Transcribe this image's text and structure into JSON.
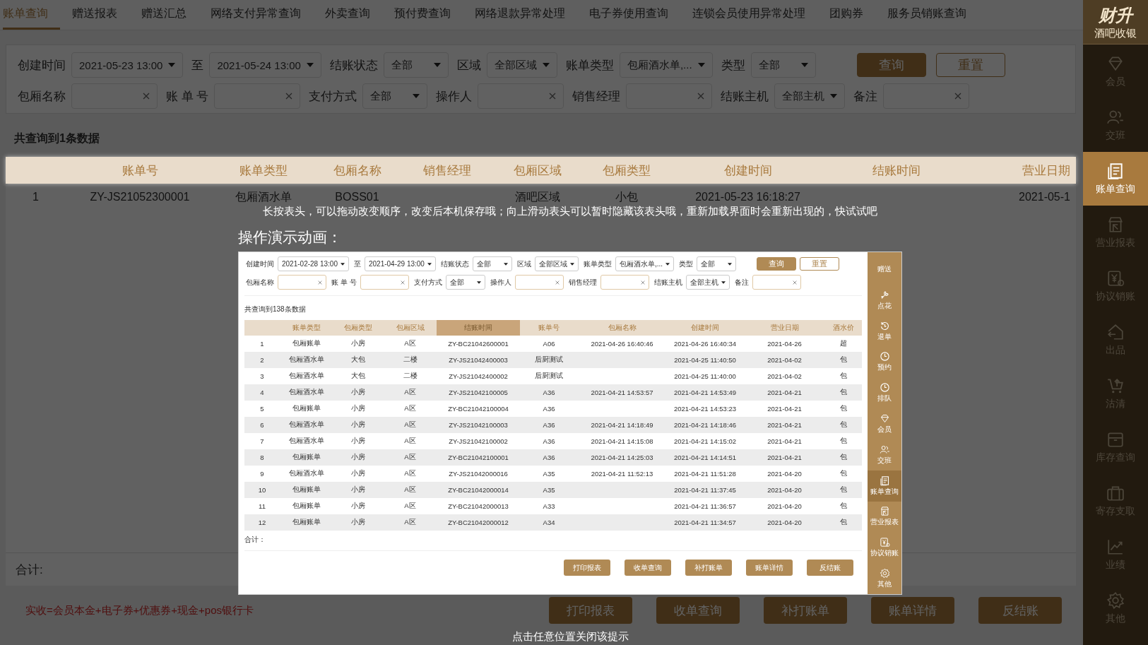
{
  "tabs": [
    {
      "label": "账单查询",
      "selected": true
    },
    {
      "label": "赠送报表",
      "selected": false
    },
    {
      "label": "赠送汇总",
      "selected": false
    },
    {
      "label": "网络支付异常查询",
      "selected": false
    },
    {
      "label": "外卖查询",
      "selected": false
    },
    {
      "label": "预付费查询",
      "selected": false
    },
    {
      "label": "网络退款异常处理",
      "selected": false
    },
    {
      "label": "电子券使用查询",
      "selected": false
    },
    {
      "label": "连锁会员使用异常处理",
      "selected": false
    },
    {
      "label": "团购券",
      "selected": false
    },
    {
      "label": "服务员销账查询",
      "selected": false
    }
  ],
  "brand": {
    "name": "财升",
    "subtitle": "酒吧收银"
  },
  "sidebar": {
    "items": [
      {
        "label": "会员",
        "selected": false
      },
      {
        "label": "交班",
        "selected": false
      },
      {
        "label": "账单查询",
        "selected": true
      },
      {
        "label": "营业报表",
        "selected": false
      },
      {
        "label": "协议销账",
        "selected": false
      },
      {
        "label": "出品",
        "selected": false
      },
      {
        "label": "沽清",
        "selected": false
      },
      {
        "label": "库存查询",
        "selected": false
      },
      {
        "label": "寄存支取",
        "selected": false
      },
      {
        "label": "业绩",
        "selected": false
      },
      {
        "label": "其他",
        "selected": false
      }
    ]
  },
  "filters": [
    [
      {
        "kind": "label",
        "text": "创建时间"
      },
      {
        "kind": "select",
        "value": "2021-05-23 13:00"
      },
      {
        "kind": "label",
        "text": "至"
      },
      {
        "kind": "select",
        "value": "2021-05-24 13:00"
      },
      {
        "kind": "label",
        "text": "结账状态"
      },
      {
        "kind": "select",
        "value": "全部"
      },
      {
        "kind": "label",
        "text": "区域"
      },
      {
        "kind": "select",
        "value": "全部区域"
      },
      {
        "kind": "label",
        "text": "账单类型"
      },
      {
        "kind": "select",
        "value": "包厢酒水单,..."
      },
      {
        "kind": "label",
        "text": "类型"
      },
      {
        "kind": "select",
        "value": "全部"
      },
      {
        "kind": "primary",
        "text": "查询"
      },
      {
        "kind": "button",
        "text": "重置"
      }
    ],
    [
      {
        "kind": "label",
        "text": "包厢名称"
      },
      {
        "kind": "input"
      },
      {
        "kind": "label",
        "text": "账 单 号"
      },
      {
        "kind": "input"
      },
      {
        "kind": "label",
        "text": "支付方式"
      },
      {
        "kind": "select",
        "value": "全部"
      },
      {
        "kind": "label",
        "text": "操作人"
      },
      {
        "kind": "input"
      },
      {
        "kind": "label",
        "text": "销售经理"
      },
      {
        "kind": "input"
      },
      {
        "kind": "label",
        "text": "结账主机"
      },
      {
        "kind": "select",
        "value": "全部主机"
      },
      {
        "kind": "label",
        "text": "备注"
      },
      {
        "kind": "input"
      }
    ]
  ],
  "result_count": "共查询到1条数据",
  "table": {
    "columns": [
      "",
      "账单号",
      "账单类型",
      "包厢名称",
      "销售经理",
      "包厢区域",
      "包厢类型",
      "创建时间",
      "结账时间",
      "营业日期"
    ],
    "rows": [
      [
        "1",
        "ZY-JS21052300001",
        "包厢酒水单",
        "BOSS01",
        "",
        "酒吧区域",
        "小包",
        "2021-05-23 16:18:27",
        "",
        "2021-05-1"
      ]
    ]
  },
  "total_label": "合计:",
  "formula_note": "实收=会员本金+电子券+优惠券+现金+pos银行卡",
  "actions": [
    "打印报表",
    "收单查询",
    "补打账单",
    "账单详情",
    "反结账"
  ],
  "tip": {
    "hint": "长按表头，可以拖动改变顺序，改变后本机保存哦；向上滑动表头可以暂时隐藏该表头哦，重新加载界面时会重新出现的，快试试吧",
    "demo_title": "操作演示动画：",
    "close_hint": "点击任意位置关闭该提示",
    "demo": {
      "filters": [
        [
          {
            "kind": "label",
            "text": "创建时间"
          },
          {
            "kind": "select",
            "value": "2021-02-28 13:00"
          },
          {
            "kind": "label",
            "text": "至"
          },
          {
            "kind": "select",
            "value": "2021-04-29 13:00"
          },
          {
            "kind": "label",
            "text": "结账状态"
          },
          {
            "kind": "select",
            "value": "全部"
          },
          {
            "kind": "label",
            "text": "区域"
          },
          {
            "kind": "select",
            "value": "全部区域"
          },
          {
            "kind": "label",
            "text": "账单类型"
          },
          {
            "kind": "select",
            "value": "包厢酒水单,..."
          },
          {
            "kind": "label",
            "text": "类型"
          },
          {
            "kind": "select",
            "value": "全部"
          },
          {
            "kind": "primary",
            "text": "查询"
          },
          {
            "kind": "button",
            "text": "重置"
          }
        ],
        [
          {
            "kind": "label",
            "text": "包厢名称"
          },
          {
            "kind": "input"
          },
          {
            "kind": "label",
            "text": "账 单 号"
          },
          {
            "kind": "input"
          },
          {
            "kind": "label",
            "text": "支付方式"
          },
          {
            "kind": "select",
            "value": "全部"
          },
          {
            "kind": "label",
            "text": "操作人"
          },
          {
            "kind": "input"
          },
          {
            "kind": "label",
            "text": "销售经理"
          },
          {
            "kind": "input"
          },
          {
            "kind": "label",
            "text": "结账主机"
          },
          {
            "kind": "select",
            "value": "全部主机"
          },
          {
            "kind": "label",
            "text": "备注"
          },
          {
            "kind": "input"
          }
        ]
      ],
      "result_count": "共查询到138条数据",
      "columns": [
        {
          "dragging": false
        },
        {
          "label": "账单类型",
          "dragging": false
        },
        {
          "label": "包厢类型",
          "dragging": false
        },
        {
          "label": "包厢区域",
          "dragging": false
        },
        {
          "label": "结账时间",
          "dragging": true
        },
        {
          "label": "账单号",
          "dragging": false
        },
        {
          "label": "包厢名称",
          "dragging": false
        },
        {
          "label": "创建时间",
          "dragging": false
        },
        {
          "label": "营业日期",
          "dragging": false
        },
        {
          "label": "酒水价",
          "dragging": false
        }
      ],
      "rows": [
        [
          "1",
          "包厢账单",
          "小房",
          "A区",
          "ZY-BC21042600001",
          "A06",
          "2021-04-26 16:40:46",
          "2021-04-26 16:40:34",
          "2021-04-26",
          "超"
        ],
        [
          "2",
          "包厢酒水单",
          "大包",
          "二楼",
          "ZY-JS21042400003",
          "后厨测试",
          "",
          "2021-04-25 11:40:50",
          "2021-04-02",
          "包"
        ],
        [
          "3",
          "包厢酒水单",
          "大包",
          "二楼",
          "ZY-JS21042400002",
          "后厨测试",
          "",
          "2021-04-25 11:40:00",
          "2021-04-02",
          "包"
        ],
        [
          "4",
          "包厢酒水单",
          "小房",
          "A区",
          "ZY-JS21042100005",
          "A36",
          "2021-04-21 14:53:57",
          "2021-04-21 14:53:49",
          "2021-04-21",
          "包"
        ],
        [
          "5",
          "包厢账单",
          "小房",
          "A区",
          "ZY-BC21042100004",
          "A36",
          "",
          "2021-04-21 14:53:23",
          "2021-04-21",
          "包"
        ],
        [
          "6",
          "包厢酒水单",
          "小房",
          "A区",
          "ZY-JS21042100003",
          "A36",
          "2021-04-21 14:18:49",
          "2021-04-21 14:18:46",
          "2021-04-21",
          "包"
        ],
        [
          "7",
          "包厢酒水单",
          "小房",
          "A区",
          "ZY-JS21042100002",
          "A36",
          "2021-04-21 14:15:08",
          "2021-04-21 14:15:02",
          "2021-04-21",
          "包"
        ],
        [
          "8",
          "包厢账单",
          "小房",
          "A区",
          "ZY-BC21042100001",
          "A36",
          "2021-04-21 14:25:03",
          "2021-04-21 14:14:51",
          "2021-04-21",
          "包"
        ],
        [
          "9",
          "包厢酒水单",
          "小房",
          "A区",
          "ZY-JS21042000016",
          "A35",
          "2021-04-21 11:52:13",
          "2021-04-21 11:51:28",
          "2021-04-20",
          "包"
        ],
        [
          "10",
          "包厢账单",
          "小房",
          "A区",
          "ZY-BC21042000014",
          "A35",
          "",
          "2021-04-21 11:37:45",
          "2021-04-20",
          "包"
        ],
        [
          "11",
          "包厢账单",
          "小房",
          "A区",
          "ZY-BC21042000013",
          "A33",
          "",
          "2021-04-21 11:36:57",
          "2021-04-20",
          "包"
        ],
        [
          "12",
          "包厢账单",
          "小房",
          "A区",
          "ZY-BC21042000012",
          "A34",
          "",
          "2021-04-21 11:34:57",
          "2021-04-20",
          "包"
        ]
      ],
      "total_label": "合计：",
      "actions": [
        "打印报表",
        "收单查询",
        "补打账单",
        "账单详情",
        "反结账"
      ],
      "sidebar": [
        {
          "label": "赠送",
          "selected": false
        },
        {
          "label": "点花",
          "selected": false
        },
        {
          "label": "退单",
          "selected": false
        },
        {
          "label": "预约",
          "selected": false
        },
        {
          "label": "排队",
          "selected": false
        },
        {
          "label": "会员",
          "selected": false
        },
        {
          "label": "交班",
          "selected": false
        },
        {
          "label": "账单查询",
          "selected": true
        },
        {
          "label": "营业报表",
          "selected": false
        },
        {
          "label": "协议销账",
          "selected": false
        },
        {
          "label": "其他",
          "selected": false
        }
      ]
    }
  }
}
